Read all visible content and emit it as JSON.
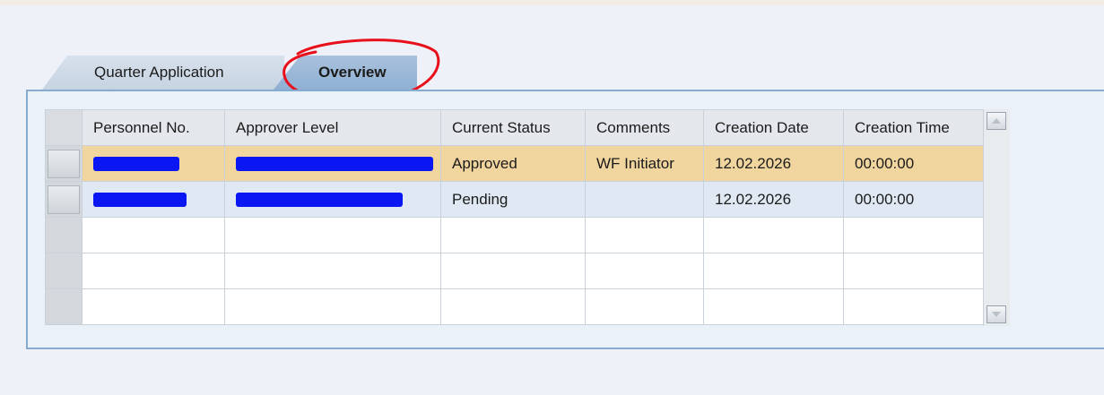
{
  "tabs": [
    {
      "label": "Quarter Application",
      "active": false
    },
    {
      "label": "Overview",
      "active": true
    }
  ],
  "table": {
    "columns": [
      "Personnel No.",
      "Approver Level",
      "Current Status",
      "Comments",
      "Creation Date",
      "Creation Time"
    ],
    "rows": [
      {
        "personnel_no": "[redacted]",
        "approver_level": "[redacted]",
        "status": "Approved",
        "comments": "WF Initiator",
        "date": "12.02.2026",
        "time": "00:00:00"
      },
      {
        "personnel_no": "[redacted]",
        "approver_level": "[redacted]",
        "status": "Pending",
        "comments": "",
        "date": "12.02.2026",
        "time": "00:00:00"
      }
    ]
  },
  "colors": {
    "selected_row": "#f1d59e",
    "alt_row": "#dfe8f3",
    "active_tab": "#8fb0d3",
    "annotation_circle": "#e8101a",
    "redaction": "#0a17f2"
  }
}
